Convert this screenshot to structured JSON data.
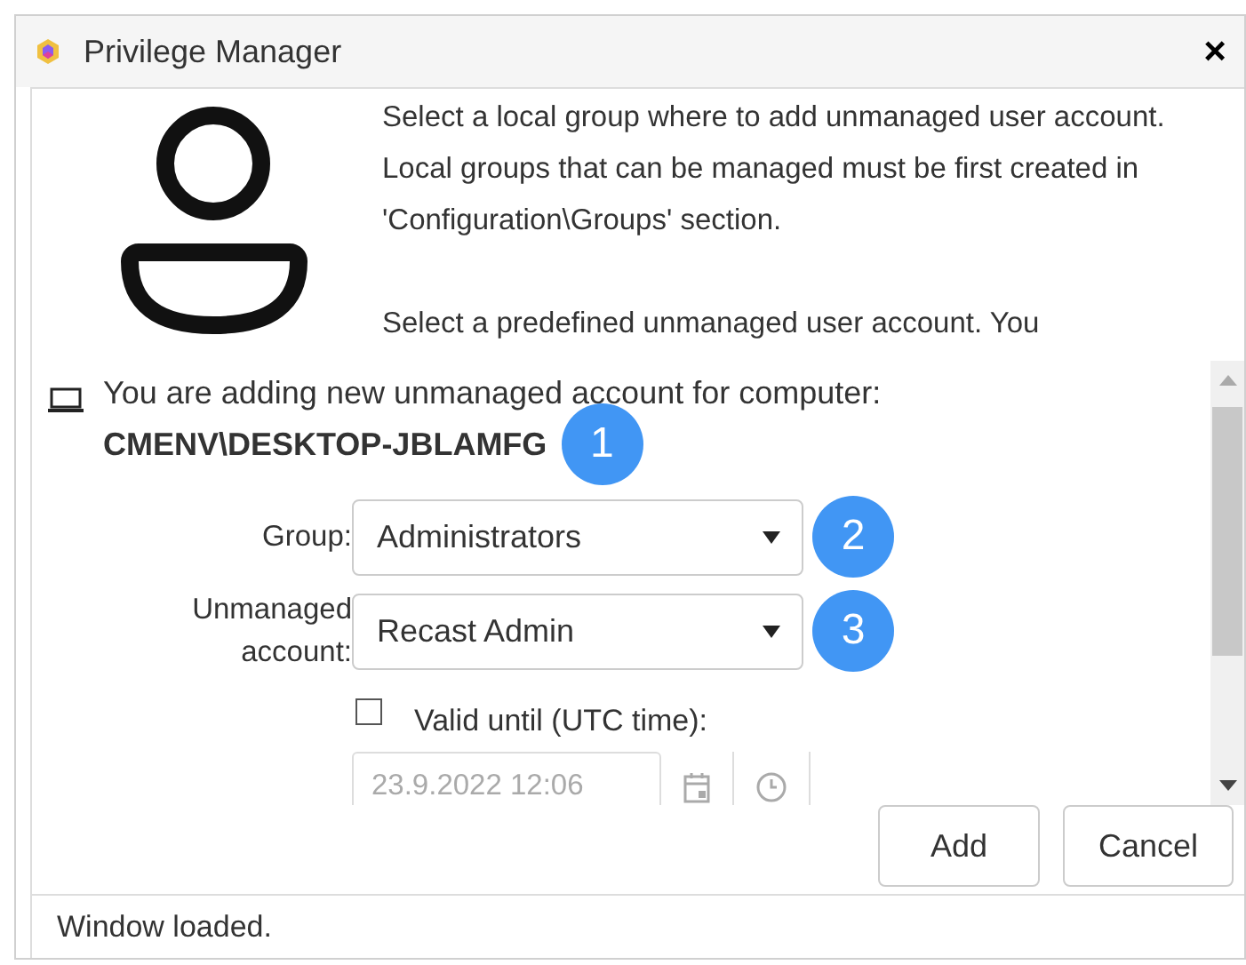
{
  "window": {
    "title": "Privilege Manager",
    "close": "×"
  },
  "intro": [
    "Select a local group where to add unmanaged user account. Local groups that can be managed must be first created in 'Configuration\\Groups' section.",
    "Select a predefined unmanaged user account. You"
  ],
  "computer": {
    "text": "You are adding new unmanaged account for computer:",
    "name": "CMENV\\DESKTOP-JBLAMFG",
    "badge": "1"
  },
  "fields": [
    {
      "label": "Group:",
      "value": "Administrators",
      "badge": "2"
    },
    {
      "label": "Unmanaged account:",
      "value": "Recast Admin",
      "badge": "3"
    }
  ],
  "valid_until": {
    "label": "Valid until (UTC time):",
    "checked": false,
    "value": "23.9.2022 12:06"
  },
  "buttons": [
    "Add",
    "Cancel"
  ],
  "status_bar": "Window loaded."
}
